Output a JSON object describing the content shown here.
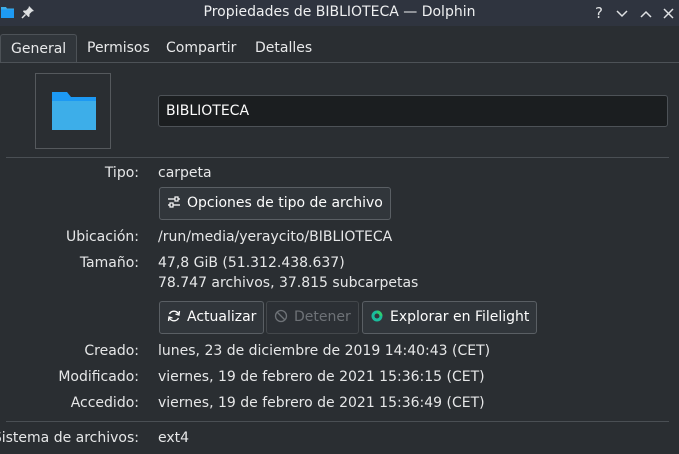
{
  "window": {
    "title": "Propiedades de BIBLIOTECA — Dolphin",
    "buttons": {
      "help": "?",
      "minimize": "∨",
      "maximize": "∧",
      "close": "✕"
    }
  },
  "tabs": [
    {
      "label": "General",
      "active": true
    },
    {
      "label": "Permisos"
    },
    {
      "label": "Compartir"
    },
    {
      "label": "Detalles"
    }
  ],
  "general": {
    "name_value": "BIBLIOTECA",
    "type": {
      "label": "Tipo:",
      "value": "carpeta",
      "button": "Opciones de tipo de archivo"
    },
    "location": {
      "label": "Ubicación:",
      "value": "/run/media/yeraycito/BIBLIOTECA"
    },
    "size": {
      "label": "Tamaño:",
      "value": "47,8 GiB (51.312.438.637)",
      "counts": "78.747 archivos, 37.815 subcarpetas",
      "buttons": {
        "refresh": "Actualizar",
        "stop": "Detener",
        "filelight": "Explorar en Filelight"
      }
    },
    "created": {
      "label": "Creado:",
      "value": "lunes, 23 de diciembre de 2019 14:40:43 (CET)"
    },
    "modified": {
      "label": "Modificado:",
      "value": "viernes, 19 de febrero de 2021 15:36:15 (CET)"
    },
    "accessed": {
      "label": "Accedido:",
      "value": "viernes, 19 de febrero de 2021 15:36:49 (CET)"
    },
    "filesystem": {
      "label": "Sistema de archivos:",
      "value": "ext4"
    }
  },
  "colors": {
    "folder": "#3daee9",
    "background": "#2a2e32",
    "titlebar": "#2f343f"
  }
}
